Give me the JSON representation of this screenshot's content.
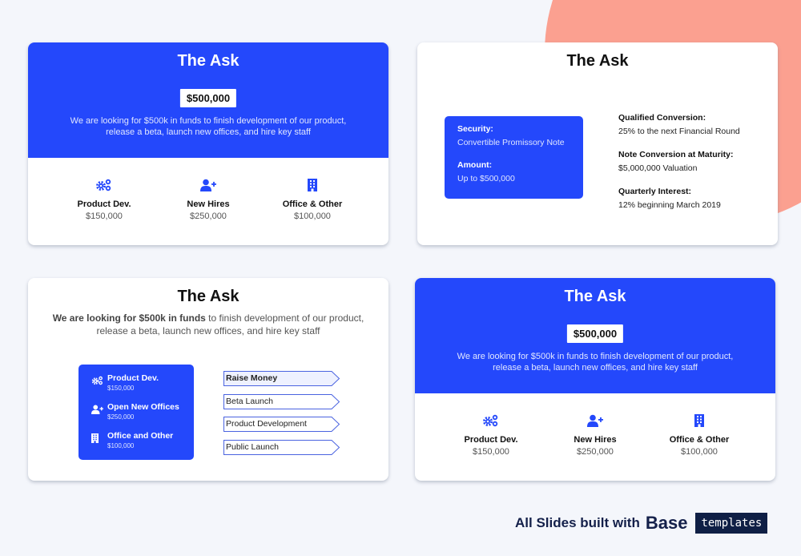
{
  "colors": {
    "accent_blue": "#2448fb",
    "blob": "#fba090",
    "background": "#f4f6fb",
    "footer_dark": "#0f1f45"
  },
  "slide1": {
    "title": "The Ask",
    "amount": "$500,000",
    "description_line1": "We are looking for $500k in funds to finish development of our product,",
    "description_line2": "release a beta, launch new offices, and hire key staff",
    "allocations": [
      {
        "icon": "gears-icon",
        "label": "Product Dev.",
        "value": "$150,000"
      },
      {
        "icon": "user-plus-icon",
        "label": "New Hires",
        "value": "$250,000"
      },
      {
        "icon": "building-icon",
        "label": "Office & Other",
        "value": "$100,000"
      }
    ]
  },
  "slide2": {
    "title": "The Ask",
    "security_label": "Security:",
    "security_value": "Convertible Promissory Note",
    "amount_label": "Amount:",
    "amount_value": "Up to $500,000",
    "terms": [
      {
        "label": "Qualified Conversion:",
        "value": "25% to the next Financial Round"
      },
      {
        "label": "Note Conversion at Maturity:",
        "value": "$5,000,000 Valuation"
      },
      {
        "label": "Quarterly Interest:",
        "value": "12% beginning March 2019"
      }
    ]
  },
  "slide3": {
    "title": "The Ask",
    "description_bold": "We are looking for $500k in funds",
    "description_rest": " to finish development of our product,",
    "description_line2": "release a beta, launch new offices, and hire key staff",
    "funds": [
      {
        "icon": "gears-icon",
        "label": "Product Dev.",
        "value": "$150,000"
      },
      {
        "icon": "user-plus-icon",
        "label": "Open New Offices",
        "value": "$250,000"
      },
      {
        "icon": "building-icon",
        "label": "Office and Other",
        "value": "$100,000"
      }
    ],
    "steps": [
      {
        "label": "Raise Money",
        "active": true
      },
      {
        "label": "Beta Launch",
        "active": false
      },
      {
        "label": "Product Development",
        "active": false
      },
      {
        "label": "Public Launch",
        "active": false
      }
    ]
  },
  "slide4": {
    "title": "The Ask",
    "amount": "$500,000",
    "description_line1": "We are looking for $500k in funds to finish development of our product,",
    "description_line2": "release a beta, launch new offices, and hire key staff",
    "allocations": [
      {
        "icon": "gears-icon",
        "label": "Product Dev.",
        "value": "$150,000"
      },
      {
        "icon": "user-plus-icon",
        "label": "New Hires",
        "value": "$250,000"
      },
      {
        "icon": "building-icon",
        "label": "Office & Other",
        "value": "$100,000"
      }
    ]
  },
  "footer": {
    "text": "All Slides built with",
    "brand": "Base",
    "tag": "templates"
  }
}
